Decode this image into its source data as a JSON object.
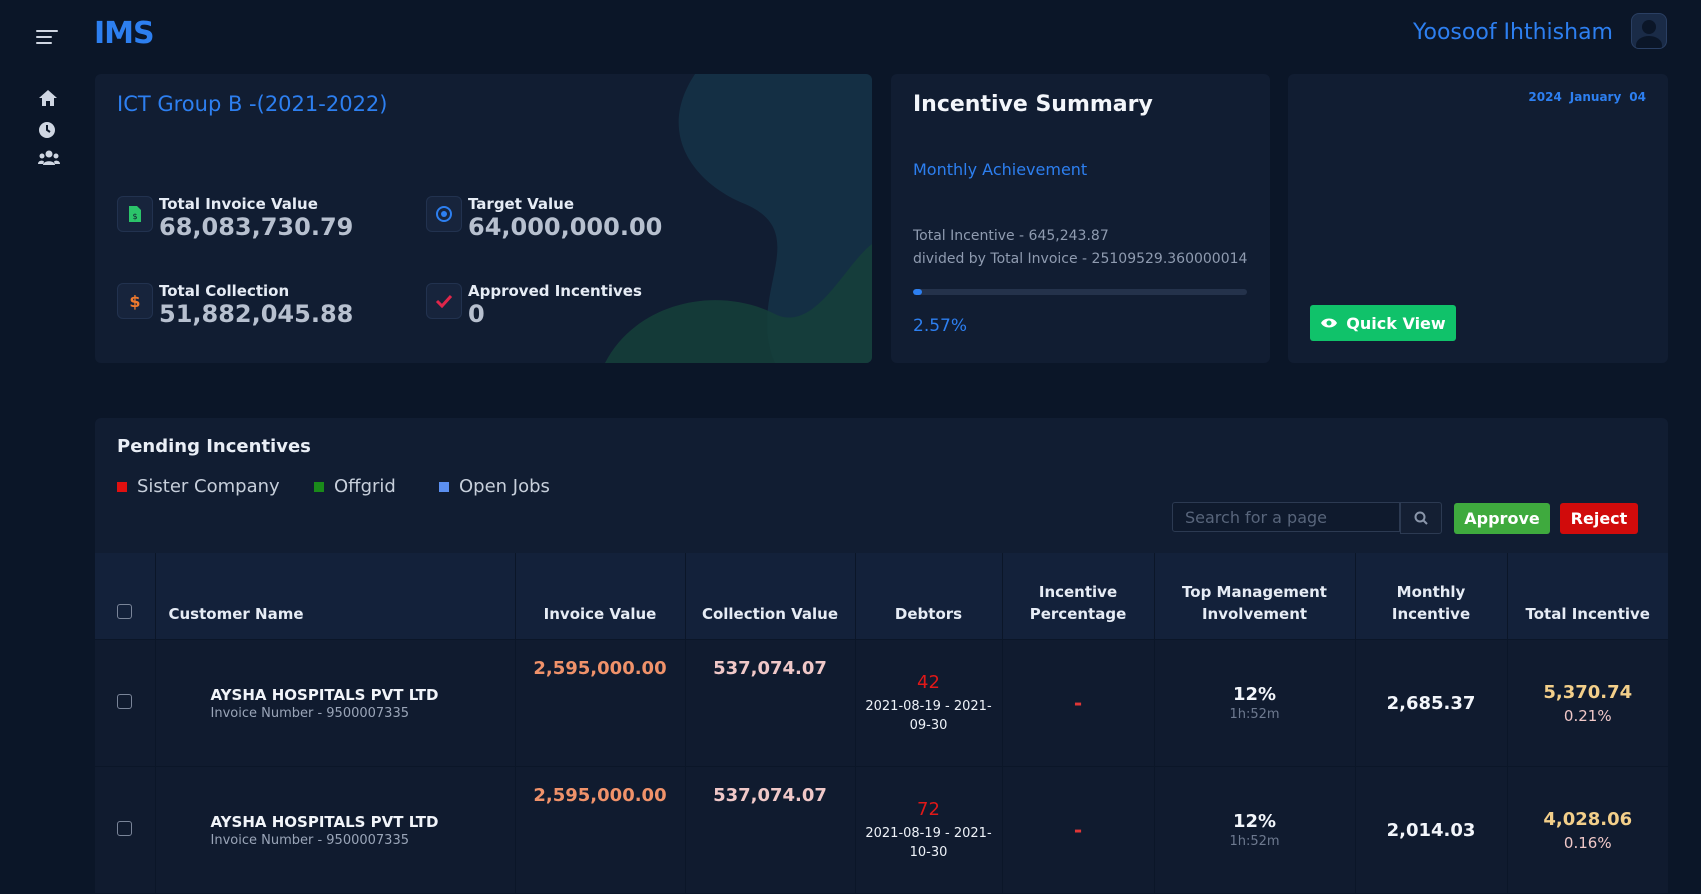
{
  "app": {
    "brand": "IMS",
    "user": "Yoosoof Ihthisham"
  },
  "nav": {
    "items": [
      "home-icon",
      "history-icon",
      "users-icon"
    ]
  },
  "group": {
    "title": "ICT Group B -(2021-2022)",
    "stats": {
      "total_invoice": {
        "label": "Total Invoice Value",
        "value": "68,083,730.79"
      },
      "target": {
        "label": "Target Value",
        "value": "64,000,000.00"
      },
      "total_collection": {
        "label": "Total Collection",
        "value": "51,882,045.88"
      },
      "approved": {
        "label": "Approved Incentives",
        "value": "0"
      }
    }
  },
  "summary": {
    "title": "Incentive Summary",
    "subtitle": "Monthly Achievement",
    "line1": "Total Incentive - 645,243.87",
    "line2": "divided by Total Invoice - 25109529.360000014",
    "percent": "2.57%",
    "progress": 0.0257
  },
  "date": {
    "year": "2024",
    "month": "January",
    "day": "04",
    "quick_view": "Quick View"
  },
  "pending": {
    "title": "Pending Incentives",
    "legend": [
      {
        "label": "Sister Company",
        "color": "#e01010"
      },
      {
        "label": "Offgrid",
        "color": "#1a8a1a"
      },
      {
        "label": "Open Jobs",
        "color": "#5b8ff0"
      }
    ],
    "search_placeholder": "Search for a page",
    "approve": "Approve",
    "reject": "Reject",
    "columns": {
      "customer": "Customer Name",
      "invoice": "Invoice Value",
      "collection": "Collection Value",
      "debtors": "Debtors",
      "incentive_pct_1": "Incentive",
      "incentive_pct_2": "Percentage",
      "top_mgmt_1": "Top Management",
      "top_mgmt_2": "Involvement",
      "monthly_1": "Monthly",
      "monthly_2": "Incentive",
      "total": "Total Incentive"
    },
    "rows": [
      {
        "customer": "AYSHA HOSPITALS PVT LTD",
        "invoice_no": "Invoice Number - 9500007335",
        "invoice_value": "2,595,000.00",
        "collection_value": "537,074.07",
        "debtors": "42",
        "debtor_dates_1": "2021-08-19 - 2021-",
        "debtor_dates_2": "09-30",
        "incentive_pct": "-",
        "top_mgmt_pct": "12%",
        "top_mgmt_time": "1h:52m",
        "monthly": "2,685.37",
        "total": "5,370.74",
        "total_pct": "0.21%"
      },
      {
        "customer": "AYSHA HOSPITALS PVT LTD",
        "invoice_no": "Invoice Number - 9500007335",
        "invoice_value": "2,595,000.00",
        "collection_value": "537,074.07",
        "debtors": "72",
        "debtor_dates_1": "2021-08-19 - 2021-",
        "debtor_dates_2": "10-30",
        "incentive_pct": "-",
        "top_mgmt_pct": "12%",
        "top_mgmt_time": "1h:52m",
        "monthly": "2,014.03",
        "total": "4,028.06",
        "total_pct": "0.16%"
      }
    ]
  }
}
